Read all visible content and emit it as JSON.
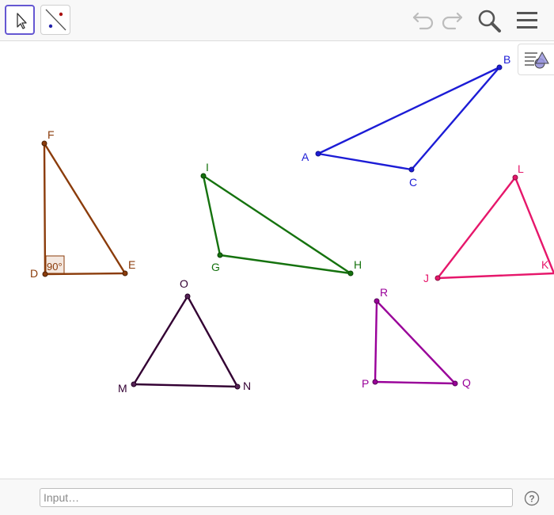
{
  "toolbar": {
    "tools": [
      {
        "icon": "move-arrow-icon",
        "active": true
      },
      {
        "icon": "line-tool-icon",
        "active": false
      }
    ],
    "right_icons": [
      "undo-icon",
      "redo-icon",
      "search-icon",
      "menu-icon"
    ]
  },
  "style_bar_toggle_icon": "style-bar-icon",
  "canvas": {
    "triangles": [
      {
        "name": "ABC",
        "color": "#1c1cd6",
        "vertices": [
          "A",
          "B",
          "C"
        ]
      },
      {
        "name": "DEF",
        "color": "#8b3c0b",
        "vertices": [
          "D",
          "E",
          "F"
        ],
        "angle_label": "90°"
      },
      {
        "name": "GHI",
        "color": "#15720e",
        "vertices": [
          "G",
          "H",
          "I"
        ]
      },
      {
        "name": "JKL",
        "color": "#e6176b",
        "vertices": [
          "J",
          "K",
          "L"
        ]
      },
      {
        "name": "MNO",
        "color": "#330033",
        "vertices": [
          "M",
          "N",
          "O"
        ]
      },
      {
        "name": "PQR",
        "color": "#990099",
        "vertices": [
          "P",
          "Q",
          "R"
        ]
      }
    ]
  },
  "input_bar": {
    "placeholder": "Input…",
    "help_icon": "help-icon"
  }
}
